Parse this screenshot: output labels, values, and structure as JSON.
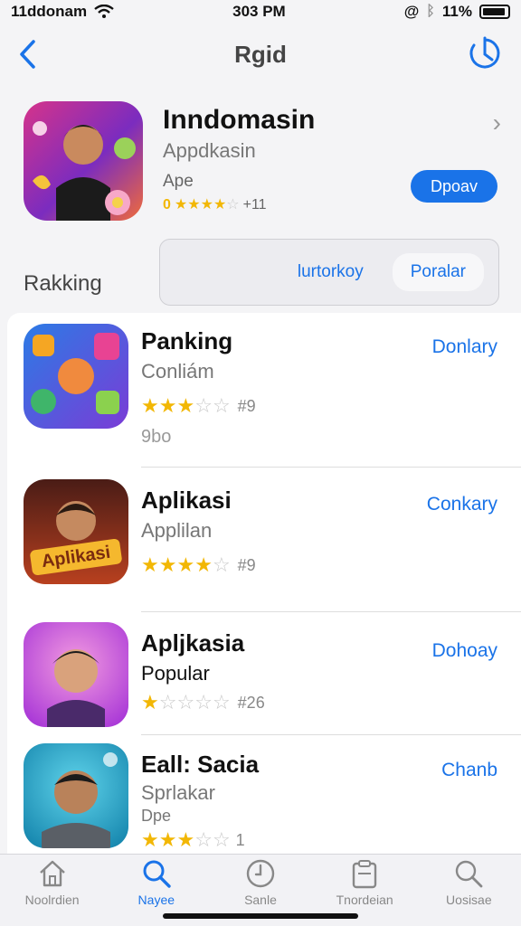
{
  "status": {
    "carrier": "11ddonam",
    "time": "303 PM",
    "battery": "11%"
  },
  "nav": {
    "title": "Rgid"
  },
  "featured": {
    "title": "Inndomasin",
    "subtitle": "Appdkasin",
    "developer": "Ape",
    "rating_value": 4,
    "rating_prefix": "0",
    "rating_count": "+11",
    "chevron": "›",
    "button": "Dpoav"
  },
  "segments": [
    {
      "label": "lurtorkoy",
      "active": false
    },
    {
      "label": "Poralar",
      "active": true
    }
  ],
  "section_title": "Rakking",
  "apps": [
    {
      "name": "Panking",
      "subtitle": "Conliám",
      "rating": 3.5,
      "count": "#9",
      "extra": "9bo",
      "action": "Donlary"
    },
    {
      "name": "Aplikasi",
      "subtitle": "Applilan",
      "rating": 4,
      "count": "#9",
      "action": "Conkary"
    },
    {
      "name": "Apljkasia",
      "subtitle": "Popular",
      "rating": 1.5,
      "count": "#26",
      "action": "Dohoay"
    },
    {
      "name": "Eall: Sacia",
      "subtitle": "Sprlakar",
      "extra": "Dpe",
      "rating": 3.5,
      "count": "1",
      "action": "Chanb"
    }
  ],
  "tabs": [
    {
      "label": "Noolrdien",
      "icon": "home-icon",
      "active": false
    },
    {
      "label": "Nayee",
      "icon": "search-icon",
      "active": true
    },
    {
      "label": "Sanle",
      "icon": "clock-icon",
      "active": false
    },
    {
      "label": "Tnordeian",
      "icon": "clipboard-icon",
      "active": false
    },
    {
      "label": "Uosisae",
      "icon": "search-icon",
      "active": false
    }
  ],
  "colors": {
    "accent": "#1a73e8",
    "star": "#f2b705"
  }
}
